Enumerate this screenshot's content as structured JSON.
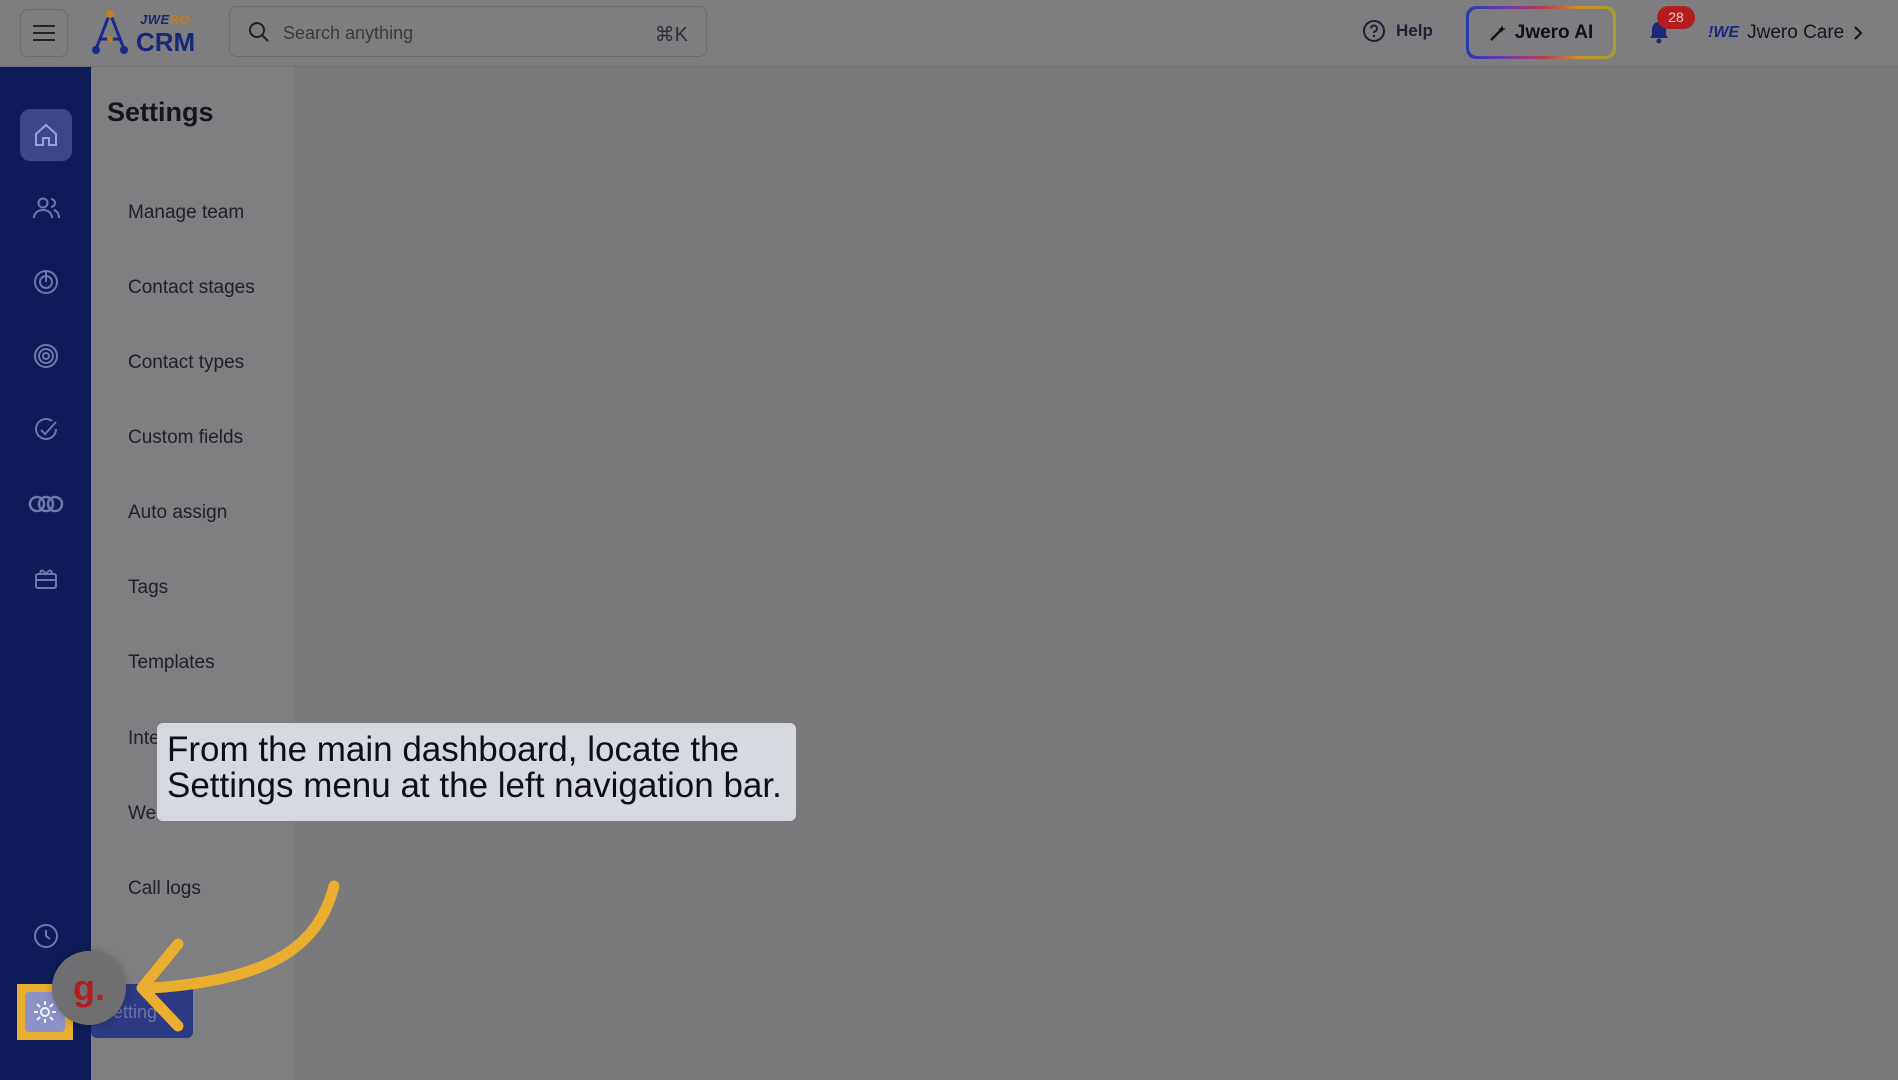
{
  "app": {
    "brand_top_a": "JWE",
    "brand_top_b": "RO",
    "brand_main": "CRM"
  },
  "header": {
    "search_placeholder": "Search anything",
    "search_shortcut": "⌘K",
    "help_label": "Help",
    "ai_label": "Jwero AI",
    "notification_count": "28",
    "care_logo": "!WE",
    "care_label": "Jwero Care"
  },
  "left_nav": {
    "items": [
      "home-icon",
      "contacts-icon",
      "leads-icon",
      "target-icon",
      "tasks-icon",
      "integrations-icon",
      "gift-icon",
      "history-icon",
      "settings-icon"
    ],
    "active": "home-icon",
    "accent": "#e9ad2f",
    "bg": "#0d1c58"
  },
  "settings": {
    "title": "Settings",
    "items": [
      "Manage team",
      "Contact stages",
      "Contact types",
      "Custom fields",
      "Auto assign",
      "Tags",
      "Templates",
      "Inte",
      "We",
      "Call logs"
    ],
    "active_label": "etting"
  },
  "tooltip": {
    "line1": "From the main dashboard, locate the",
    "line2": "Settings menu at the left navigation bar."
  },
  "avatar": {
    "letter": "g."
  }
}
